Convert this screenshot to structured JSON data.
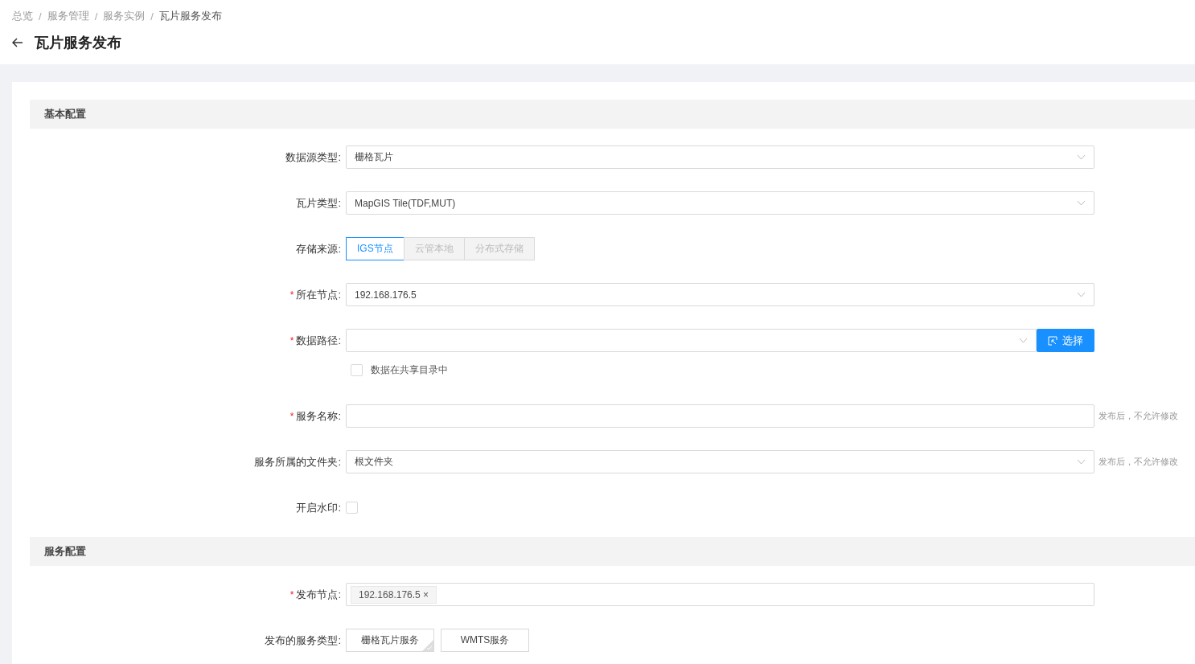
{
  "breadcrumb": [
    {
      "label": "总览"
    },
    {
      "separator": "/",
      "label": "服务管理"
    },
    {
      "separator": "/",
      "label": "服务实例"
    },
    {
      "separator": "/",
      "label": "瓦片服务发布"
    }
  ],
  "title": "瓦片服务发布",
  "sections": [
    {
      "title": "基本配置",
      "fields": [
        {
          "kind": "select",
          "label": "数据源类型:",
          "value": "栅格瓦片"
        },
        {
          "kind": "select",
          "label": "瓦片类型:",
          "value": "MapGIS Tile(TDF,MUT)"
        },
        {
          "kind": "radio",
          "label": "存储来源:",
          "options": [
            {
              "label": "IGS节点",
              "selected": true
            },
            {
              "label": "云管本地",
              "selected": false
            },
            {
              "label": "分布式存储",
              "selected": false
            }
          ]
        },
        {
          "kind": "select",
          "label": "所在节点:",
          "required_mark": "*",
          "value": "192.168.176.5"
        },
        {
          "kind": "select-button",
          "label": "数据路径:",
          "required_mark": "*",
          "button": "选择",
          "share": {
            "label": "数据在共享目录中",
            "checked": false
          }
        },
        {
          "kind": "input",
          "label": "服务名称:",
          "required_mark": "*",
          "note": "发布后，不允许修改"
        },
        {
          "kind": "select",
          "label": "服务所属的文件夹:",
          "value": "根文件夹",
          "note": "发布后，不允许修改"
        },
        {
          "kind": "checkbox",
          "label": "开启水印:",
          "checked": false
        }
      ]
    },
    {
      "title": "服务配置",
      "fields": [
        {
          "kind": "tags",
          "label": "发布节点:",
          "required_mark": "*",
          "tags": [
            "192.168.176.5 ×"
          ]
        },
        {
          "kind": "cards",
          "label": "发布的服务类型:",
          "options": [
            {
              "label": "栅格瓦片服务",
              "selected": true
            },
            {
              "label": "WMTS服务",
              "selected": false
            }
          ]
        }
      ]
    }
  ]
}
